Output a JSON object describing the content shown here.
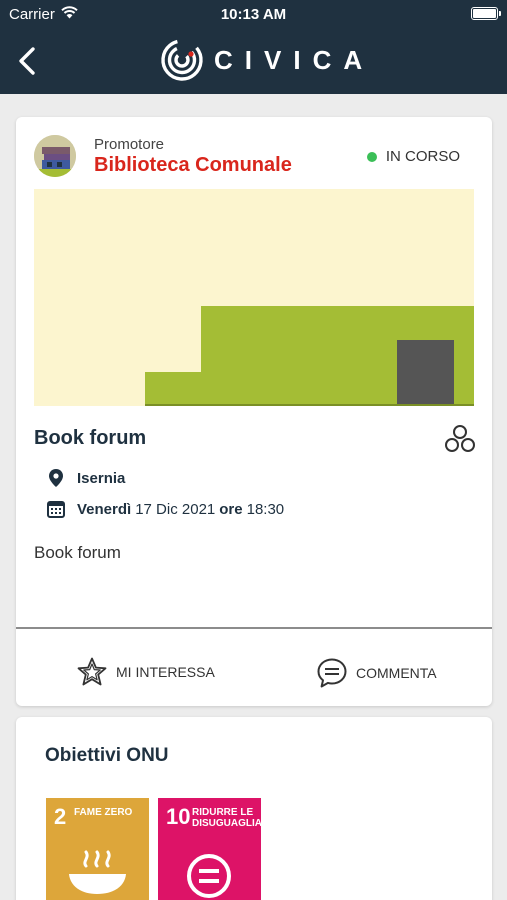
{
  "status_bar": {
    "carrier": "Carrier",
    "time": "10:13 AM"
  },
  "navbar": {
    "logo_text": "CIVICA"
  },
  "event": {
    "promoter_label": "Promotore",
    "promoter_name": "Biblioteca Comunale",
    "status": "IN CORSO",
    "title": "Book forum",
    "location": "Isernia",
    "date_day": "Venerdì",
    "date_value": "17 Dic 2021",
    "date_time_label": "ore",
    "time": "18:30",
    "description": "Book forum"
  },
  "actions": {
    "like_label": "MI INTERESSA",
    "comment_label": "COMMENTA"
  },
  "onu": {
    "title": "Obiettivi ONU",
    "goals": [
      {
        "number": "2",
        "label": "FAME ZERO",
        "color": "#dda63a"
      },
      {
        "number": "10",
        "label": "RIDURRE LE DISUGUAGLIANZE",
        "color": "#dd1367"
      }
    ]
  },
  "colors": {
    "header_bg": "#1f3140",
    "promoter_red": "#d9261c",
    "status_green": "#3bbf57",
    "hero_sky": "#fcf5cf",
    "hero_green": "#a4bd35",
    "hero_door": "#555555"
  }
}
